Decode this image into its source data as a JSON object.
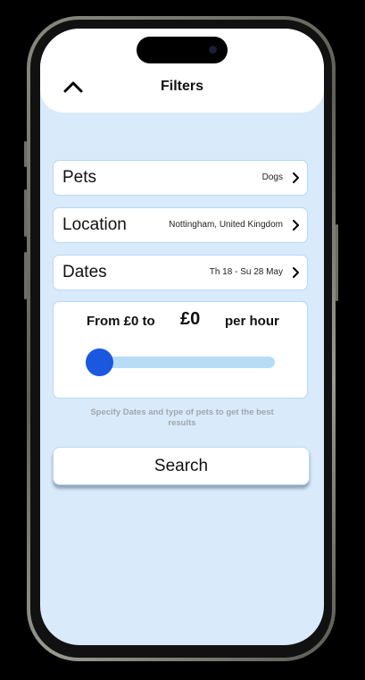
{
  "header": {
    "title": "Filters",
    "back_icon": "chevron-up-icon"
  },
  "filters": [
    {
      "label": "Pets",
      "value": "Dogs"
    },
    {
      "label": "Location",
      "value": "Nottingham, United Kingdom"
    },
    {
      "label": "Dates",
      "value": "Th 18 - Su 28 May"
    }
  ],
  "price": {
    "from_label": "From £0 to",
    "amount": "£0",
    "unit": "per hour",
    "slider_value_fraction": 0
  },
  "hint": "Specify Dates and type of pets to get the best results",
  "search_button": "Search",
  "colors": {
    "background": "#d9eafb",
    "accent": "#1b58df",
    "track": "#b7dcf6",
    "border": "#b6d9f5"
  }
}
